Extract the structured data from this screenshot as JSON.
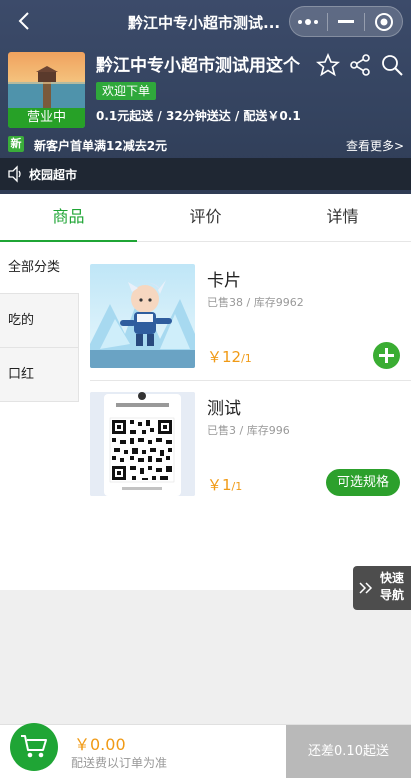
{
  "nav": {
    "title": "黔江中专小超市测试..."
  },
  "shop": {
    "name": "黔江中专小超市测试用这个",
    "status": "营业中",
    "welcome_tag": "欢迎下单",
    "meta": "0.1元起送 / 32分钟送达 / 配送￥0.1",
    "promo_badge": "新",
    "promo_text": "新客户首单满12减去2元",
    "see_more": "查看更多>",
    "notice": "校园超市"
  },
  "tabs": [
    {
      "label": "商品"
    },
    {
      "label": "评价"
    },
    {
      "label": "详情"
    }
  ],
  "categories": [
    {
      "label": "全部分类"
    },
    {
      "label": "吃的"
    },
    {
      "label": "口红"
    }
  ],
  "products": [
    {
      "name": "卡片",
      "sold": "已售38 / 库存9962",
      "price": "￥12",
      "unit": "/1"
    },
    {
      "name": "测试",
      "sold": "已售3 / 库存996",
      "price": "￥1",
      "unit": "/1",
      "action": "可选规格"
    }
  ],
  "quick_nav": {
    "line1": "快速",
    "line2": "导航"
  },
  "cart": {
    "total": "￥0.00",
    "shipping_note": "配送费以订单为准",
    "checkout": "还差0.10起送"
  },
  "colors": {
    "brand_green": "#1fa535",
    "price_orange": "#f09a15",
    "header_bg": "#3c4b6a"
  }
}
